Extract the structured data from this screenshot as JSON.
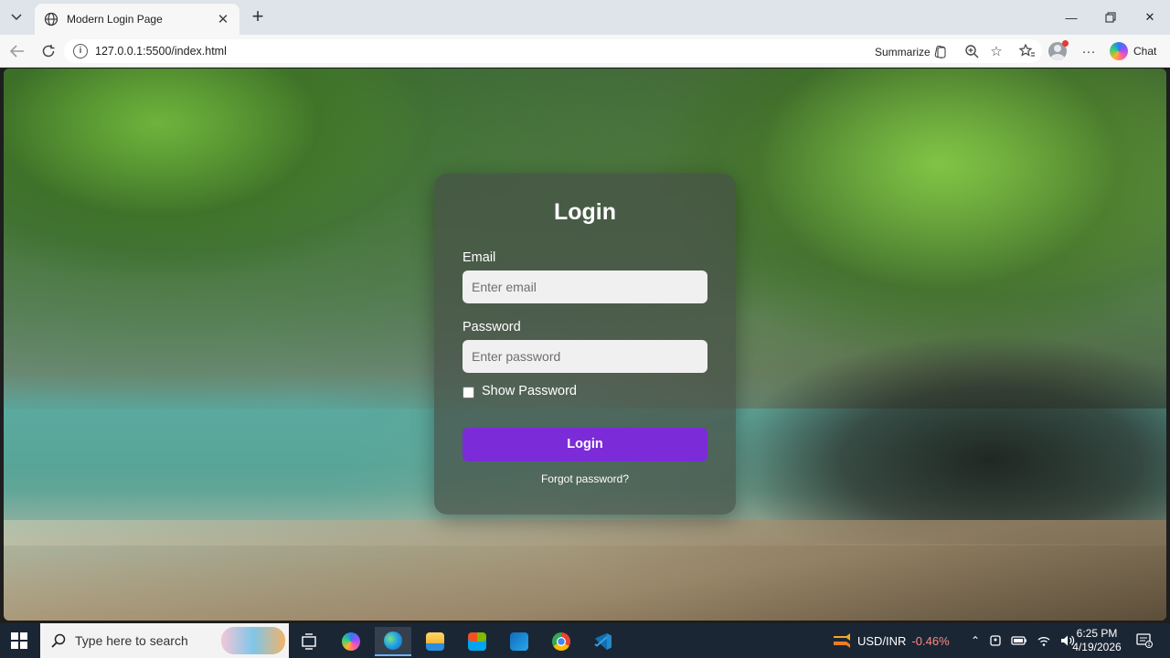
{
  "browser": {
    "tab_title": "Modern Login Page",
    "url": "127.0.0.1:5500/index.html",
    "summarize_label": "Summarize",
    "chat_label": "Chat"
  },
  "login": {
    "heading": "Login",
    "email_label": "Email",
    "email_placeholder": "Enter email",
    "email_value": "",
    "password_label": "Password",
    "password_placeholder": "Enter password",
    "password_value": "",
    "show_password_label": "Show Password",
    "show_password_checked": false,
    "login_button": "Login",
    "forgot_link": "Forgot password?"
  },
  "taskbar": {
    "search_placeholder": "Type here to search",
    "ticker_label": "USD/INR",
    "ticker_change": "-0.46%",
    "time": "6:25 PM",
    "date": "4/19/2026"
  },
  "colors": {
    "login_button": "#7c2bd9",
    "ticker_change": "#ff8a80",
    "taskbar_bg": "#1b2635"
  },
  "icons": [
    "tab-list-icon",
    "globe-icon",
    "close-icon",
    "new-tab-icon",
    "minimize-icon",
    "maximize-icon",
    "window-close-icon",
    "back-icon",
    "refresh-icon",
    "site-info-icon",
    "summarize-icon",
    "zoom-icon",
    "favorite-star-icon",
    "favorites-icon",
    "profile-avatar",
    "more-icon",
    "copilot-icon",
    "windows-start-icon",
    "search-icon",
    "task-view-icon",
    "copilot-taskbar-icon",
    "edge-icon",
    "file-explorer-icon",
    "store-icon",
    "outlook-icon",
    "chrome-icon",
    "vscode-icon",
    "chevron-up-icon",
    "wifi-icon",
    "battery-icon",
    "volume-icon",
    "notification-icon"
  ]
}
